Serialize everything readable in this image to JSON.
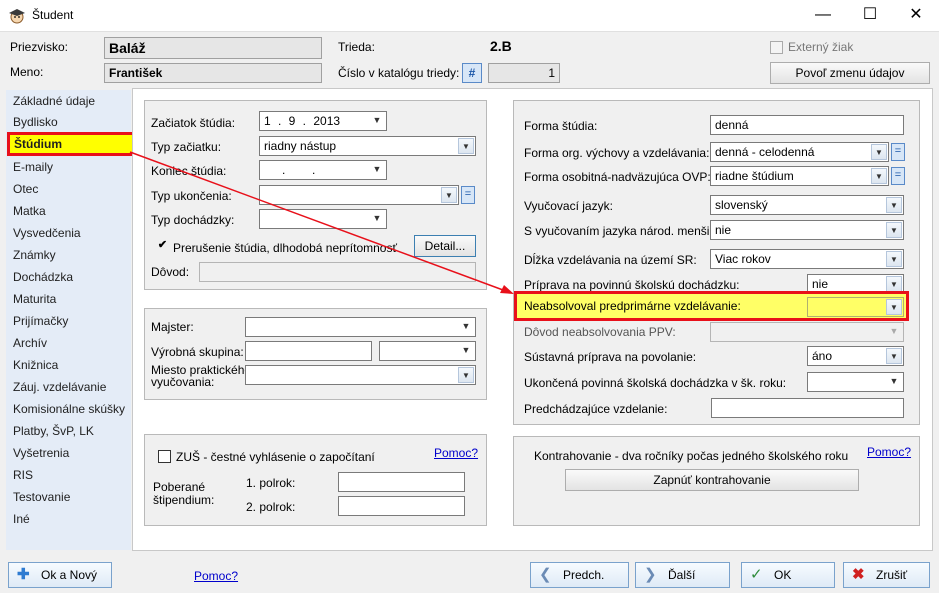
{
  "window": {
    "title": "Študent"
  },
  "header": {
    "priezvisko_label": "Priezvisko:",
    "priezvisko_value": "Baláž",
    "meno_label": "Meno:",
    "meno_value": "František",
    "trieda_label": "Trieda:",
    "trieda_value": "2.B",
    "cislo_label": "Číslo v katalógu triedy:",
    "cislo_btn": "#",
    "cislo_value": "1",
    "externy_label": "Externý žiak",
    "povol_button": "Povoľ zmenu údajov"
  },
  "sidebar": {
    "items": [
      {
        "label": "Základné údaje"
      },
      {
        "label": "Bydlisko"
      },
      {
        "label": "Štúdium"
      },
      {
        "label": "E-maily"
      },
      {
        "label": "Otec"
      },
      {
        "label": "Matka"
      },
      {
        "label": "Vysvedčenia"
      },
      {
        "label": "Známky"
      },
      {
        "label": "Dochádzka"
      },
      {
        "label": "Maturita"
      },
      {
        "label": "Prijímačky"
      },
      {
        "label": "Archív"
      },
      {
        "label": "Knižnica"
      },
      {
        "label": "Záuj. vzdelávanie"
      },
      {
        "label": "Komisionálne skúšky"
      },
      {
        "label": "Platby, ŠvP, LK"
      },
      {
        "label": "Vyšetrenia"
      },
      {
        "label": "RIS"
      },
      {
        "label": "Testovanie"
      },
      {
        "label": "Iné"
      }
    ]
  },
  "studium": {
    "zaciatok_label": "Začiatok štúdia:",
    "zaciatok_value": "1 .   9 .  2013",
    "typ_zaciatku_label": "Typ začiatku:",
    "typ_zaciatku_value": "riadny nástup",
    "koniec_label": "Koniec štúdia:",
    "koniec_value": ".        .",
    "typ_ukoncenia_label": "Typ ukončenia:",
    "typ_dochadzky_label": "Typ dochádzky:",
    "prerusenie_label": "Prerušenie štúdia, dlhodobá neprítomnosť",
    "detail_button": "Detail...",
    "dovod_label": "Dôvod:"
  },
  "majster": {
    "majster_label": "Majster:",
    "vyrobna_label": "Výrobná skupina:",
    "miesto_label_1": "Miesto praktického",
    "miesto_label_2": "vyučovania:"
  },
  "zus": {
    "zus_label": "ZUŠ - čestné vyhlásenie o započítaní",
    "pomoc": "Pomoc?",
    "poberane_1": "Poberané",
    "poberane_2": "štipendium:",
    "polrok1_label": "1. polrok:",
    "polrok2_label": "2. polrok:"
  },
  "forma": {
    "forma_label": "Forma štúdia:",
    "forma_value": "denná",
    "org_label": "Forma org. výchovy a vzdelávania:",
    "org_value": "denná - celodenná",
    "osobitna_label": "Forma osobitná-nadväzujúca OVP:",
    "osobitna_value": "riadne štúdium",
    "jazyk_label": "Vyučovací jazyk:",
    "jazyk_value": "slovenský",
    "narod_label": "S vyučovaním jazyka národ. menšiny:",
    "narod_value": "nie",
    "dlzka_label": "Dĺžka vzdelávania na území SR:",
    "dlzka_value": "Viac rokov",
    "priprava_label": "Príprava na povinnú školskú dochádzku:",
    "priprava_value": "nie",
    "neabsolvoval_label": "Neabsolvoval predprimárne vzdelávanie:",
    "dovod_ppv_label": "Dôvod neabsolvovania PPV:",
    "sustavna_label": "Sústavná príprava na povolanie:",
    "sustavna_value": "áno",
    "ukoncena_label": "Ukončená povinná školská dochádzka v šk. roku:",
    "predchadzajuce_label": "Predchádzajúce vzdelanie:"
  },
  "kontra": {
    "label": "Kontrahovanie - dva ročníky počas jedného školského roku",
    "pomoc": "Pomoc?",
    "button": "Zapnúť kontrahovanie"
  },
  "footer": {
    "ok_novy": "Ok a Nový",
    "pomoc": "Pomoc?",
    "predch": "Predch.",
    "dalsi": "Ďalší",
    "ok": "OK",
    "zrusit": "Zrušiť"
  },
  "colors": {
    "highlight_red": "#e8101a",
    "highlight_yellow": "#ffff00",
    "nav_bg": "#e4ecf7"
  }
}
